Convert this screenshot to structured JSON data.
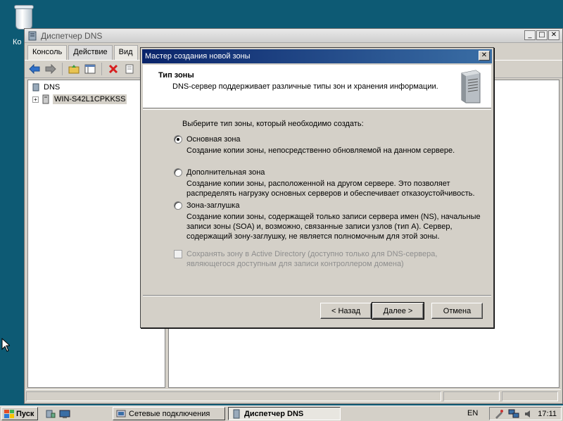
{
  "desktop": {
    "recycle_label": "Ко"
  },
  "main_window": {
    "title": "Диспетчер DNS",
    "menu": [
      "Консоль",
      "Действие",
      "Вид"
    ],
    "tree": {
      "root": "DNS",
      "server": "WIN-S42L1CPKKSS"
    }
  },
  "dialog": {
    "title": "Мастер создания новой зоны",
    "header_title": "Тип зоны",
    "header_subtitle": "DNS-сервер поддерживает различные типы зон и хранения информации.",
    "prompt": "Выберите тип зоны, который необходимо создать:",
    "options": [
      {
        "label": "Основная зона",
        "desc": "Создание копии зоны, непосредственно обновляемой на данном сервере.",
        "selected": true
      },
      {
        "label": "Дополнительная зона",
        "desc": "Создание копии зоны, расположенной на другом сервере. Это позволяет распределять нагрузку основных серверов и обеспечивает отказоустойчивость.",
        "selected": false
      },
      {
        "label": "Зона-заглушка",
        "desc": "Создание копии зоны, содержащей только записи сервера имен (NS), начальные записи зоны (SOA) и, возможно, связанные записи узлов (тип A). Сервер, содержащий зону-заглушку, не является полномочным для этой зоны.",
        "selected": false
      }
    ],
    "ad_checkbox": "Сохранять зону в Active Directory (доступно только для DNS-сервера, являющегося доступным для записи контроллером домена)",
    "buttons": {
      "back": "< Назад",
      "next": "Далее >",
      "cancel": "Отмена"
    }
  },
  "taskbar": {
    "start": "Пуск",
    "tasks": [
      "Сетевые подключения",
      "Диспетчер DNS"
    ],
    "lang": "EN",
    "time": "17:11"
  }
}
